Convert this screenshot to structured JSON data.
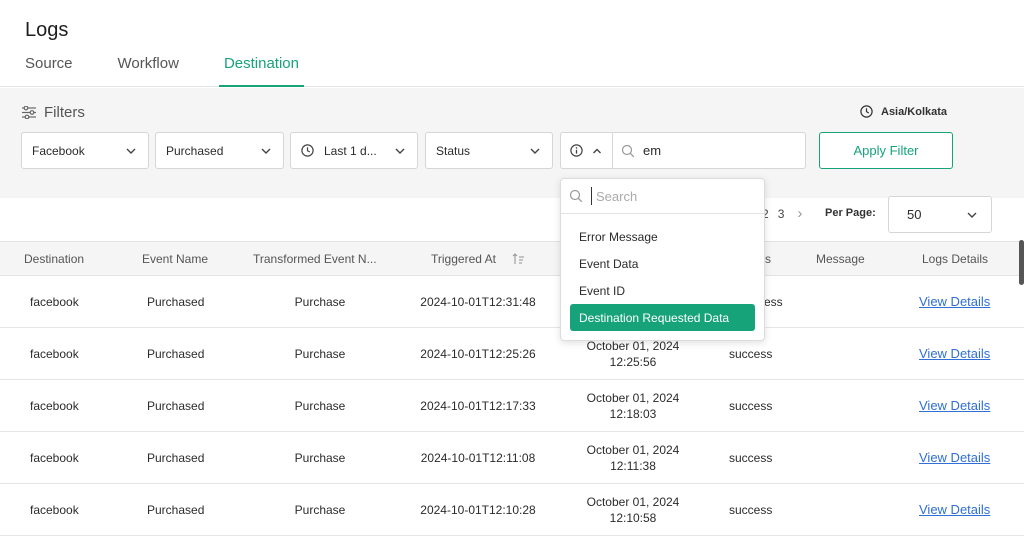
{
  "header": {
    "title": "Logs",
    "tabs": [
      "Source",
      "Workflow",
      "Destination"
    ],
    "active_tab": "Destination"
  },
  "filters": {
    "label": "Filters",
    "timezone": "Asia/Kolkata",
    "destination": "Facebook",
    "event": "Purchased",
    "time_range": "Last 1 d...",
    "status": "Status",
    "search_value": "em",
    "apply_label": "Apply Filter"
  },
  "search_dropdown": {
    "placeholder": "Search",
    "options": [
      "Error Message",
      "Event Data",
      "Event ID",
      "Destination Requested Data"
    ],
    "selected": "Destination Requested Data"
  },
  "pagination": {
    "pages": [
      "2",
      "3"
    ],
    "next": "›",
    "per_page_label": "Per Page:",
    "per_page_value": "50"
  },
  "table": {
    "columns": [
      "Destination",
      "Event Name",
      "Transformed Event N...",
      "Triggered At",
      "",
      "s",
      "Message",
      "Logs Details"
    ],
    "rows": [
      {
        "destination": "facebook",
        "event": "Purchased",
        "transformed": "Purchase",
        "triggered": "2024-10-01T12:31:48",
        "date": "",
        "time": "",
        "status": "ccess",
        "message": "",
        "details": "View Details"
      },
      {
        "destination": "facebook",
        "event": "Purchased",
        "transformed": "Purchase",
        "triggered": "2024-10-01T12:25:26",
        "date": "October 01, 2024",
        "time": "12:25:56",
        "status": "success",
        "message": "",
        "details": "View Details"
      },
      {
        "destination": "facebook",
        "event": "Purchased",
        "transformed": "Purchase",
        "triggered": "2024-10-01T12:17:33",
        "date": "October 01, 2024",
        "time": "12:18:03",
        "status": "success",
        "message": "",
        "details": "View Details"
      },
      {
        "destination": "facebook",
        "event": "Purchased",
        "transformed": "Purchase",
        "triggered": "2024-10-01T12:11:08",
        "date": "October 01, 2024",
        "time": "12:11:38",
        "status": "success",
        "message": "",
        "details": "View Details"
      },
      {
        "destination": "facebook",
        "event": "Purchased",
        "transformed": "Purchase",
        "triggered": "2024-10-01T12:10:28",
        "date": "October 01, 2024",
        "time": "12:10:58",
        "status": "success",
        "message": "",
        "details": "View Details"
      }
    ]
  },
  "colors": {
    "accent": "#16a37a",
    "link": "#2f6fd6",
    "panel_bg": "#f5f5f5"
  }
}
